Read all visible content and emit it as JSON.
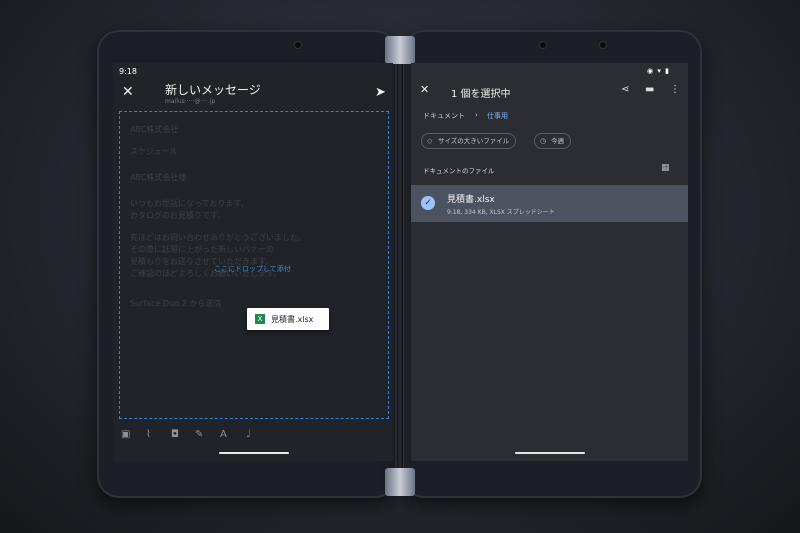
{
  "left": {
    "status_time": "9:18",
    "title": "新しいメッセージ",
    "from": "mailus·····@····.jp",
    "draft_lines": [
      "ABC株式会社",
      "スケジュール",
      "ABC株式会社様",
      "いつもお世話になっております。",
      "カタログのお見積りです。",
      "先ほどはお問い合わせありがとうございました。",
      "その際に話題に上がった新しいバナーの",
      "見積もりをお送りさせていただきます。",
      "ご確認のほどよろしくお願いいたします。",
      "Surface Duo 2 から送信"
    ],
    "drop_text": "ここにドロップして添付",
    "drag_file": "見積書.xlsx",
    "drag_badge": "X"
  },
  "right": {
    "title": "1 個を選択中",
    "breadcrumb": {
      "root": "ドキュメント",
      "sep": "›",
      "current": "仕事用"
    },
    "chips": [
      {
        "label": "サイズの大きいファイル",
        "icon": "tag-icon"
      },
      {
        "label": "今週",
        "icon": "history-icon"
      }
    ],
    "section_title": "ドキュメントのファイル",
    "file": {
      "name": "見積書.xlsx",
      "meta": "9:18, 334 KB, XLSX スプレッドシート"
    }
  },
  "colors": {
    "accent": "#2f82d6",
    "selected_row": "#4b5260",
    "check": "#9fc3ff"
  }
}
